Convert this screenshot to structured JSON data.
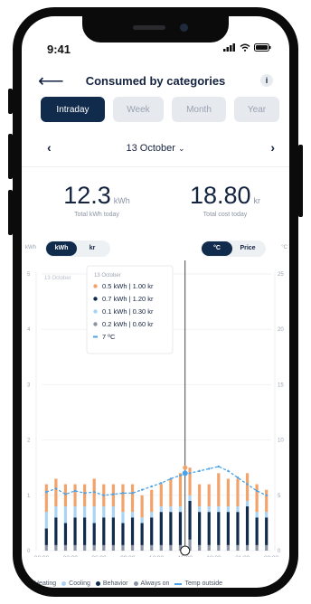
{
  "status": {
    "time": "9:41"
  },
  "header": {
    "title": "Consumed by categories",
    "back_icon": "arrow-left-icon",
    "info_label": "i"
  },
  "tabs": [
    {
      "label": "Intraday",
      "active": true
    },
    {
      "label": "Week",
      "active": false
    },
    {
      "label": "Month",
      "active": false
    },
    {
      "label": "Year",
      "active": false
    }
  ],
  "date_nav": {
    "date": "13 October",
    "dropdown_glyph": "⌄",
    "prev_glyph": "‹",
    "next_glyph": "›"
  },
  "stats": {
    "energy": {
      "value": "12.3",
      "unit": "kWh",
      "label": "Total kWh today"
    },
    "cost": {
      "value": "18.80",
      "unit": "kr",
      "label": "Total cost today"
    }
  },
  "toggles": {
    "left_axis_unit": "kWh",
    "right_axis_unit": "°C",
    "unit_options": [
      "kWh",
      "kr"
    ],
    "unit_selected": "kWh",
    "overlay_options": [
      "°C",
      "Price"
    ],
    "overlay_selected": "°C"
  },
  "tooltip": {
    "date": "13 October",
    "rows": [
      {
        "text": "0.5 kWh | 1.00 kr",
        "color": "#f2a36b"
      },
      {
        "text": "0.7 kWh | 1.20 kr",
        "color": "#102b4c"
      },
      {
        "text": "0.1 kWh | 0.30 kr",
        "color": "#a9d4f5"
      },
      {
        "text": "0.2 kWh | 0.60 kr",
        "color": "#8a94a3"
      },
      {
        "text": "7 ºC",
        "color": "#4aa3e8"
      }
    ]
  },
  "chart_data": {
    "type": "bar",
    "stacked": true,
    "chart_label": "13 October",
    "y_left": {
      "ticks": [
        "0",
        "1",
        "2",
        "3",
        "4",
        "5"
      ],
      "range": [
        0,
        5
      ]
    },
    "y_right": {
      "ticks": [
        "0",
        "5",
        "10",
        "15",
        "20",
        "25"
      ],
      "range": [
        0,
        25
      ]
    },
    "x_ticks": [
      "00:00",
      "03:00",
      "06:00",
      "09:00",
      "12:00",
      "15:00",
      "18:00",
      "21:00",
      "00:00"
    ],
    "hours": 24,
    "series": [
      {
        "name": "Always on",
        "color": "#8a94a3",
        "values": [
          0.1,
          0.1,
          0.1,
          0.1,
          0.1,
          0.1,
          0.1,
          0.1,
          0.1,
          0.1,
          0.1,
          0.1,
          0.1,
          0.1,
          0.1,
          0.2,
          0.1,
          0.1,
          0.1,
          0.1,
          0.1,
          0.1,
          0.1,
          0.1
        ]
      },
      {
        "name": "Behavior",
        "color": "#102b4c",
        "values": [
          0.3,
          0.5,
          0.4,
          0.5,
          0.5,
          0.4,
          0.5,
          0.5,
          0.4,
          0.5,
          0.4,
          0.5,
          0.6,
          0.6,
          0.6,
          0.7,
          0.6,
          0.6,
          0.6,
          0.6,
          0.6,
          0.7,
          0.5,
          0.5
        ]
      },
      {
        "name": "Cooling",
        "color": "#a9d4f5",
        "values": [
          0.3,
          0.2,
          0.3,
          0.2,
          0.2,
          0.3,
          0.2,
          0.2,
          0.2,
          0.1,
          0.1,
          0.1,
          0.1,
          0.1,
          0.1,
          0.1,
          0.1,
          0.1,
          0.1,
          0.1,
          0.1,
          0.1,
          0.1,
          0.1
        ]
      },
      {
        "name": "Heating",
        "color": "#f2a36b",
        "values": [
          0.5,
          0.5,
          0.4,
          0.4,
          0.4,
          0.5,
          0.4,
          0.4,
          0.5,
          0.5,
          0.4,
          0.4,
          0.4,
          0.5,
          0.6,
          0.5,
          0.4,
          0.4,
          0.6,
          0.5,
          0.5,
          0.5,
          0.5,
          0.4
        ]
      }
    ],
    "temperature": {
      "name": "Temp outside",
      "color": "#4aa3e8",
      "values": [
        5.3,
        5.6,
        5.1,
        5.4,
        5.2,
        5.3,
        5.0,
        5.1,
        5.2,
        5.2,
        5.5,
        5.8,
        6.1,
        6.5,
        6.8,
        7.0,
        7.2,
        7.4,
        7.6,
        7.2,
        6.6,
        6.0,
        5.4,
        5.0
      ]
    },
    "selected_hour": 15
  },
  "legend": [
    {
      "label": "Heating",
      "color": "#f2a36b",
      "kind": "dot"
    },
    {
      "label": "Cooling",
      "color": "#a9d4f5",
      "kind": "dot"
    },
    {
      "label": "Behavior",
      "color": "#102b4c",
      "kind": "dot"
    },
    {
      "label": "Always on",
      "color": "#8a94a3",
      "kind": "dot"
    },
    {
      "label": "Temp outside",
      "color": "#4aa3e8",
      "kind": "dash"
    }
  ]
}
